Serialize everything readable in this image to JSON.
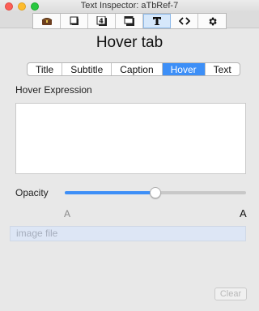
{
  "window": {
    "title": "Text Inspector: aTbRef-7"
  },
  "toolbar": {
    "tools": [
      {
        "icon": "treasure-box-icon"
      },
      {
        "icon": "note-icon"
      },
      {
        "icon": "number-four-icon"
      },
      {
        "icon": "shadow-box-icon"
      },
      {
        "icon": "text-t-icon",
        "selected": true
      },
      {
        "icon": "code-brackets-icon"
      },
      {
        "icon": "gear-icon"
      }
    ]
  },
  "heading": "Hover tab",
  "tabs": [
    {
      "label": "Title"
    },
    {
      "label": "Subtitle"
    },
    {
      "label": "Caption"
    },
    {
      "label": "Hover",
      "active": true
    },
    {
      "label": "Text"
    }
  ],
  "hover_expression": {
    "label": "Hover Expression",
    "value": ""
  },
  "opacity": {
    "label": "Opacity",
    "value_fraction": 0.5,
    "min_label": "A",
    "max_label": "A"
  },
  "image_file": {
    "placeholder": "image file"
  },
  "clear_button": {
    "label": "Clear",
    "enabled": false
  },
  "colors": {
    "accent": "#3d8ff7",
    "selected_tool_bg": "#d6e8fb"
  }
}
